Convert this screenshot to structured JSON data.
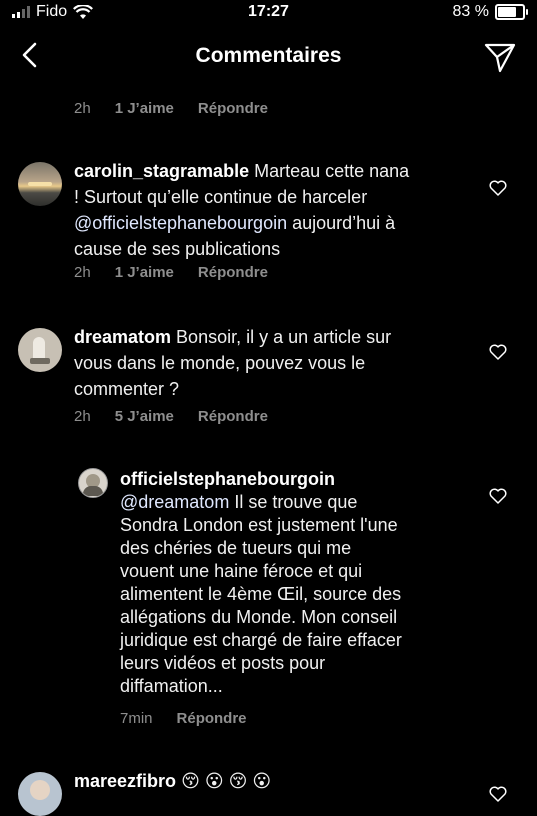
{
  "status": {
    "carrier": "Fido",
    "time": "17:27",
    "battery": "83 %",
    "battery_level": 0.83
  },
  "header": {
    "title": "Commentaires"
  },
  "top_meta": {
    "time": "2h",
    "likes": "1 J’aime",
    "reply": "Répondre"
  },
  "comments": [
    {
      "user": "carolin_stagramable",
      "lines": [
        "Marteau cette nana",
        "! Surtout qu’elle continue de harceler",
        "@officielstephanebourgoin",
        " aujourd’hui à",
        "cause de ses publications"
      ],
      "time": "2h",
      "likes": "1 J’aime",
      "reply": "Répondre"
    },
    {
      "user": "dreamatom",
      "lines": [
        "Bonsoir, il y a un article sur",
        "vous dans le monde, pouvez vous le",
        "commenter ?"
      ],
      "time": "2h",
      "likes": "5 J’aime",
      "reply": "Répondre"
    },
    {
      "user": "officielstephanebourgoin",
      "mention": "@dreamatom",
      "lines": [
        " Il se trouve que",
        "Sondra London est justement l'une",
        "des chéries de tueurs qui me",
        "vouent une haine féroce et qui",
        "alimentent le 4ème Œil, source des",
        "allégations du Monde. Mon conseil",
        "juridique est chargé de faire effacer",
        "leurs vidéos et posts pour",
        "diffamation..."
      ],
      "time": "7min",
      "reply": "Répondre"
    },
    {
      "user": "mareezfibro",
      "emoji": "😚 😮 😚 😮"
    }
  ]
}
